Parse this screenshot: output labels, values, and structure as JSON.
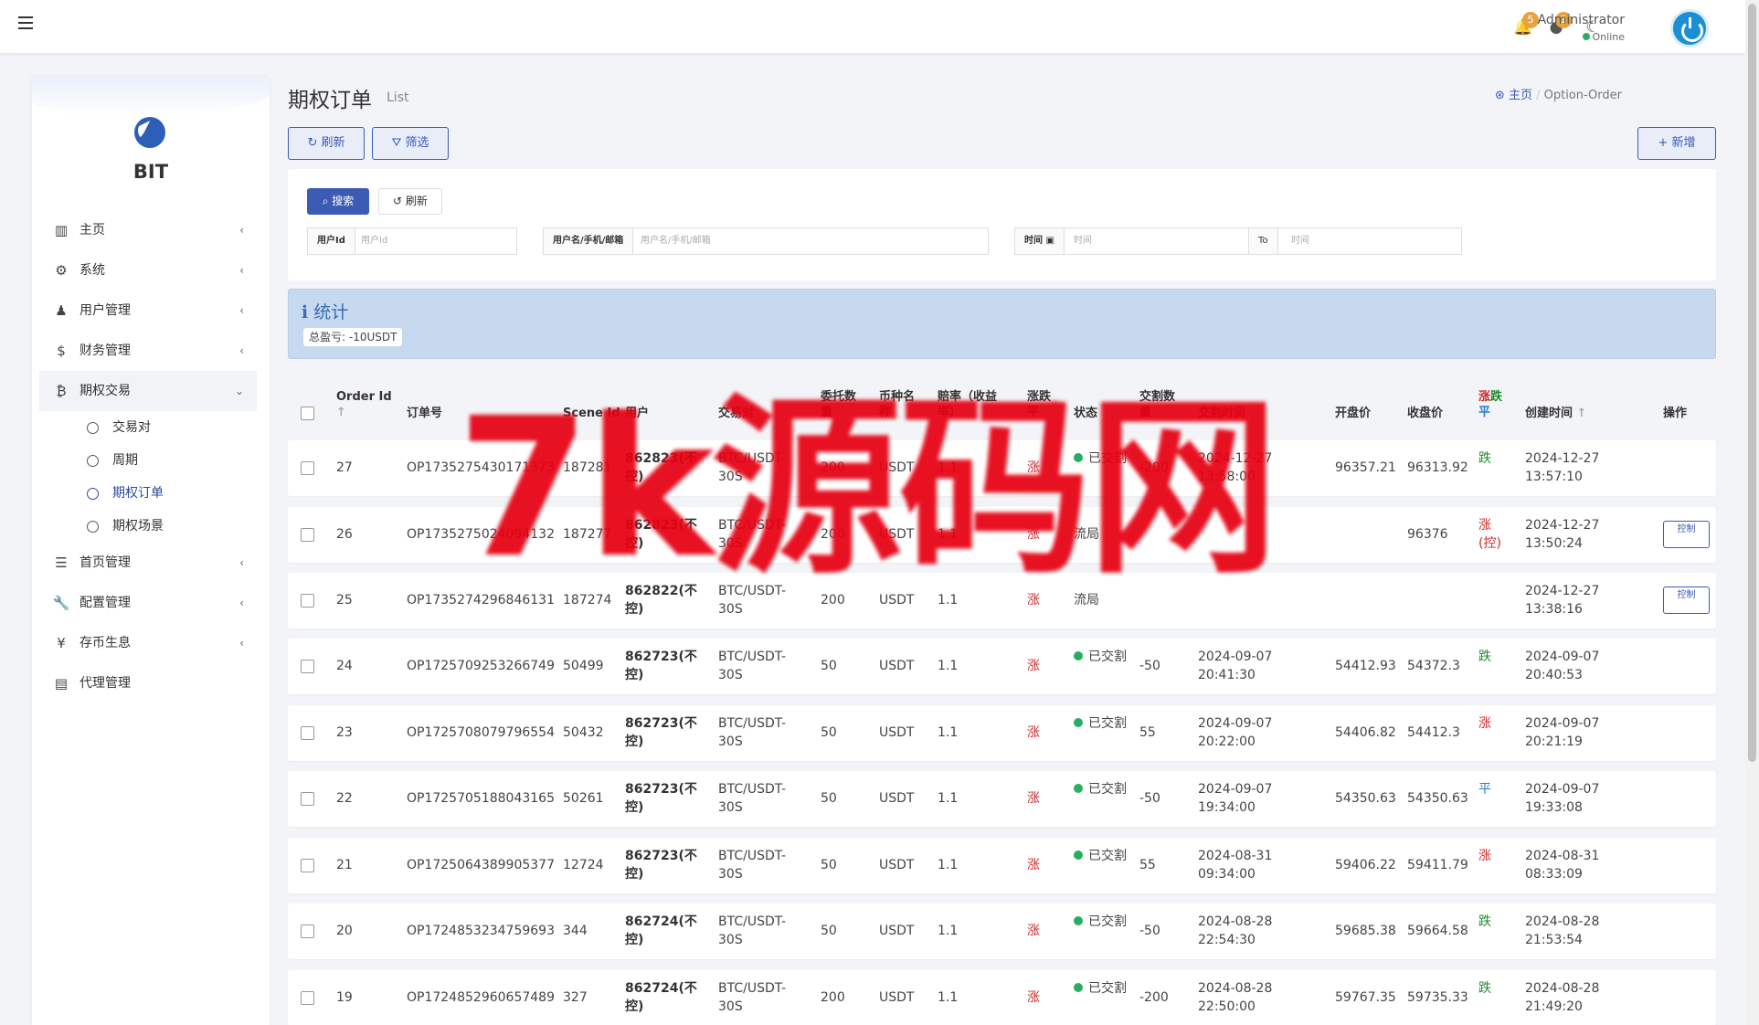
{
  "topbar": {
    "notif_count": "5",
    "alert_count": "1",
    "user_name": "Administrator",
    "user_status": "Online"
  },
  "sidebar": {
    "brand": "BIT",
    "items": [
      {
        "label": "主页",
        "icon": "bar-chart-icon"
      },
      {
        "label": "系统",
        "icon": "gear-icon"
      },
      {
        "label": "用户管理",
        "icon": "users-icon"
      },
      {
        "label": "财务管理",
        "icon": "dollar-icon"
      },
      {
        "label": "期权交易",
        "icon": "bitcoin-icon"
      },
      {
        "label": "首页管理",
        "icon": "list-icon"
      },
      {
        "label": "配置管理",
        "icon": "wrench-icon"
      },
      {
        "label": "存币生息",
        "icon": "yen-icon"
      },
      {
        "label": "代理管理",
        "icon": "id-card-icon"
      }
    ],
    "sub_items": [
      "交易对",
      "周期",
      "期权订单",
      "期权场景"
    ]
  },
  "page": {
    "title": "期权订单",
    "subtitle": "List",
    "crumb_home": "主页",
    "crumb_current": "Option-Order",
    "refresh_label": "刷新",
    "filter_label": "筛选",
    "add_label": "新增"
  },
  "search": {
    "search_label": "搜索",
    "reset_label": "刷新",
    "user_id_label": "用户Id",
    "user_id_placeholder": "用户Id",
    "user_name_label": "用户名/手机/邮箱",
    "user_name_placeholder": "用户名/手机/邮箱",
    "time_label": "时间",
    "time_placeholder": "时间",
    "to_label": "To",
    "time_to_placeholder": "时间"
  },
  "stats": {
    "title": "统计",
    "total_label": "总盈亏: -10USDT"
  },
  "table": {
    "headers": {
      "order_id": "Order Id",
      "order_no": "订单号",
      "scene_id": "Scene Id",
      "user": "用户",
      "pair": "交易对",
      "amount": "委托数量",
      "coin": "币种名称",
      "rate": "赔率（收益率）",
      "direction": "涨跌平",
      "status": "状态",
      "settle_amount": "交割数量",
      "settle_time": "交割时间",
      "open_price": "开盘价",
      "close_price": "收盘价",
      "result_up": "涨",
      "result_down": "跌",
      "result_flat": "平",
      "created": "创建时间",
      "action": "操作"
    },
    "rows": [
      {
        "id": "27",
        "no": "OP1735275430171373",
        "scene": "187281",
        "user": "862823(不控)",
        "pair": "BTC/USDT-30S",
        "amount": "200",
        "coin": "USDT",
        "rate": "1.1",
        "dir": "涨",
        "status": "已交割",
        "settle": "-200",
        "stime": "2024-12-27 13:58:00",
        "open": "96357.21",
        "close": "96313.92",
        "result": "跌",
        "rclass": "down",
        "created": "2024-12-27 13:57:10",
        "action": ""
      },
      {
        "id": "26",
        "no": "OP1735275024094132",
        "scene": "187277",
        "user": "862823(不控)",
        "pair": "BTC/USDT-30S",
        "amount": "200",
        "coin": "USDT",
        "rate": "1.1",
        "dir": "涨",
        "status": "流局",
        "settle": "",
        "stime": "",
        "open": "",
        "close": "96376",
        "result": "涨(控)",
        "rclass": "up",
        "created": "2024-12-27 13:50:24",
        "action": "控制"
      },
      {
        "id": "25",
        "no": "OP1735274296846131",
        "scene": "187274",
        "user": "862822(不控)",
        "pair": "BTC/USDT-30S",
        "amount": "200",
        "coin": "USDT",
        "rate": "1.1",
        "dir": "涨",
        "status": "流局",
        "settle": "",
        "stime": "",
        "open": "",
        "close": "",
        "result": "",
        "rclass": "",
        "created": "2024-12-27 13:38:16",
        "action": "控制"
      },
      {
        "id": "24",
        "no": "OP1725709253266749",
        "scene": "50499",
        "user": "862723(不控)",
        "pair": "BTC/USDT-30S",
        "amount": "50",
        "coin": "USDT",
        "rate": "1.1",
        "dir": "涨",
        "status": "已交割",
        "settle": "-50",
        "stime": "2024-09-07 20:41:30",
        "open": "54412.93",
        "close": "54372.3",
        "result": "跌",
        "rclass": "down",
        "created": "2024-09-07 20:40:53",
        "action": ""
      },
      {
        "id": "23",
        "no": "OP1725708079796554",
        "scene": "50432",
        "user": "862723(不控)",
        "pair": "BTC/USDT-30S",
        "amount": "50",
        "coin": "USDT",
        "rate": "1.1",
        "dir": "涨",
        "status": "已交割",
        "settle": "55",
        "stime": "2024-09-07 20:22:00",
        "open": "54406.82",
        "close": "54412.3",
        "result": "涨",
        "rclass": "up",
        "created": "2024-09-07 20:21:19",
        "action": ""
      },
      {
        "id": "22",
        "no": "OP1725705188043165",
        "scene": "50261",
        "user": "862723(不控)",
        "pair": "BTC/USDT-30S",
        "amount": "50",
        "coin": "USDT",
        "rate": "1.1",
        "dir": "涨",
        "status": "已交割",
        "settle": "-50",
        "stime": "2024-09-07 19:34:00",
        "open": "54350.63",
        "close": "54350.63",
        "result": "平",
        "rclass": "flat",
        "created": "2024-09-07 19:33:08",
        "action": ""
      },
      {
        "id": "21",
        "no": "OP1725064389905377",
        "scene": "12724",
        "user": "862723(不控)",
        "pair": "BTC/USDT-30S",
        "amount": "50",
        "coin": "USDT",
        "rate": "1.1",
        "dir": "涨",
        "status": "已交割",
        "settle": "55",
        "stime": "2024-08-31 09:34:00",
        "open": "59406.22",
        "close": "59411.79",
        "result": "涨",
        "rclass": "up",
        "created": "2024-08-31 08:33:09",
        "action": ""
      },
      {
        "id": "20",
        "no": "OP1724853234759693",
        "scene": "344",
        "user": "862724(不控)",
        "pair": "BTC/USDT-30S",
        "amount": "50",
        "coin": "USDT",
        "rate": "1.1",
        "dir": "涨",
        "status": "已交割",
        "settle": "-50",
        "stime": "2024-08-28 22:54:30",
        "open": "59685.38",
        "close": "59664.58",
        "result": "跌",
        "rclass": "down",
        "created": "2024-08-28 21:53:54",
        "action": ""
      },
      {
        "id": "19",
        "no": "OP1724852960657489",
        "scene": "327",
        "user": "862724(不控)",
        "pair": "BTC/USDT-30S",
        "amount": "200",
        "coin": "USDT",
        "rate": "1.1",
        "dir": "涨",
        "status": "已交割",
        "settle": "-200",
        "stime": "2024-08-28 22:50:00",
        "open": "59767.35",
        "close": "59735.33",
        "result": "跌",
        "rclass": "down",
        "created": "2024-08-28 21:49:20",
        "action": ""
      }
    ]
  },
  "watermark": "7k源码网",
  "colors": {
    "accent": "#3b5bb5",
    "up": "#d02828",
    "down": "#1f8a2c",
    "flat": "#2a7bd6",
    "online": "#27ae60"
  }
}
